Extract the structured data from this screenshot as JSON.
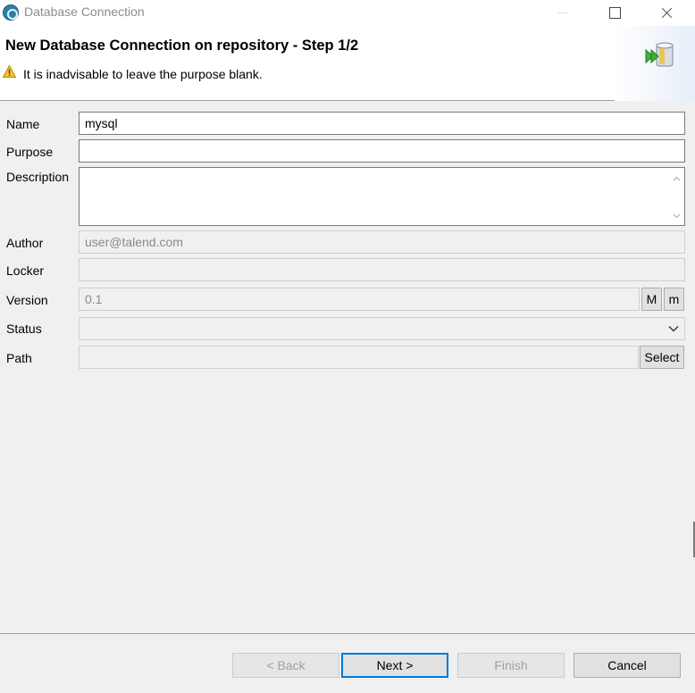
{
  "window": {
    "title": "Database Connection"
  },
  "header": {
    "title": "New Database Connection on repository - Step 1/2",
    "warning": "It is inadvisable to leave the purpose blank."
  },
  "form": {
    "name_label": "Name",
    "name_value": "mysql",
    "purpose_label": "Purpose",
    "purpose_value": "",
    "description_label": "Description",
    "description_value": "",
    "author_label": "Author",
    "author_value": "user@talend.com",
    "locker_label": "Locker",
    "locker_value": "",
    "version_label": "Version",
    "version_value": "0.1",
    "version_major_button": "M",
    "version_minor_button": "m",
    "status_label": "Status",
    "status_value": "",
    "path_label": "Path",
    "path_value": "",
    "select_button": "Select"
  },
  "buttons": {
    "back": "< Back",
    "next": "Next >",
    "finish": "Finish",
    "cancel": "Cancel"
  },
  "colors": {
    "accent": "#0078d7",
    "warning": "#f4c430",
    "wizard_arrow": "#3cb33c"
  }
}
